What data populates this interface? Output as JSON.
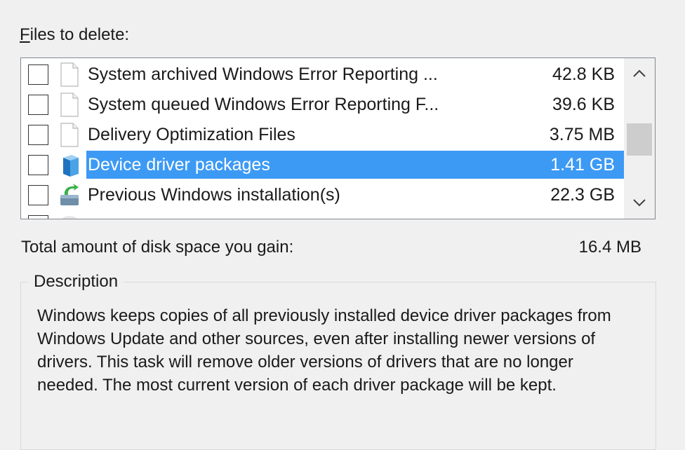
{
  "files_label": {
    "accel": "F",
    "rest": "iles to delete:"
  },
  "files": [
    {
      "label": "System archived Windows Error Reporting ...",
      "size": "42.8 KB",
      "icon": "document-icon",
      "checked": false,
      "selected": false
    },
    {
      "label": "System queued Windows Error Reporting F...",
      "size": "39.6 KB",
      "icon": "document-icon",
      "checked": false,
      "selected": false
    },
    {
      "label": "Delivery Optimization Files",
      "size": "3.75 MB",
      "icon": "document-icon",
      "checked": false,
      "selected": false
    },
    {
      "label": "Device driver packages",
      "size": "1.41 GB",
      "icon": "driver-package-icon",
      "checked": false,
      "selected": true
    },
    {
      "label": "Previous Windows installation(s)",
      "size": "22.3 GB",
      "icon": "windows-installation-icon",
      "checked": false,
      "selected": false
    }
  ],
  "total": {
    "label": "Total amount of disk space you gain:",
    "value": "16.4 MB"
  },
  "description": {
    "title": "Description",
    "text": "Windows keeps copies of all previously installed device driver packages from Windows Update and other sources, even after installing newer versions of drivers. This task will remove older versions of drivers that are no longer needed. The most current version of each driver package will be kept."
  },
  "colors": {
    "selection": "#3c9af4",
    "window_bg": "#f0f0f0"
  }
}
